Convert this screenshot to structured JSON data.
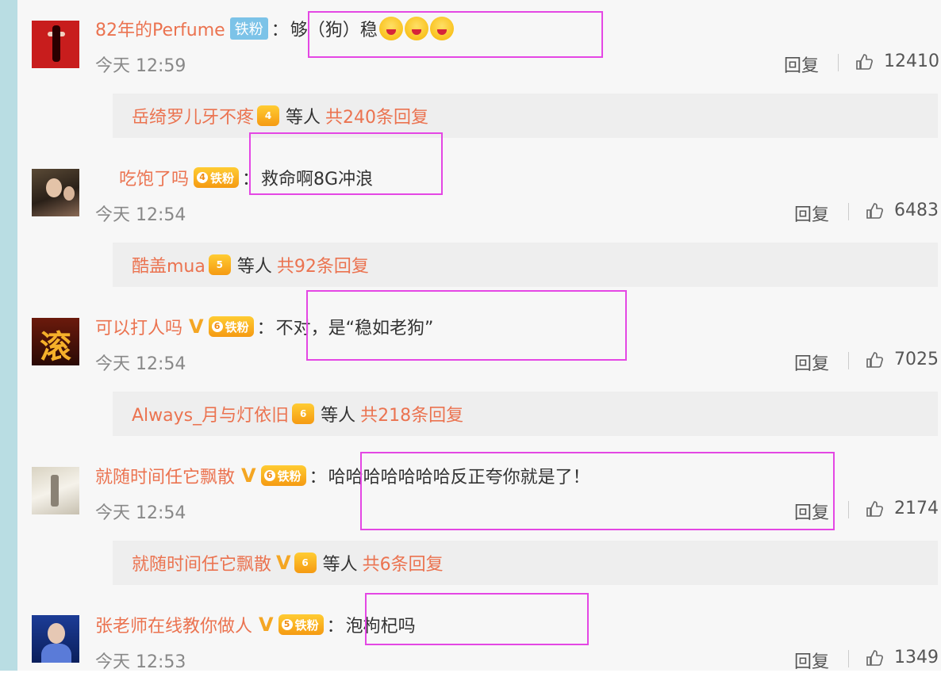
{
  "comments": [
    {
      "username": "82年的Perfume",
      "badge": "铁粉",
      "text": "够（狗）稳",
      "time": "今天 12:59",
      "reply": "回复",
      "likes": "12410",
      "has_v": false,
      "level": ""
    },
    {
      "username": "吃饱了吗",
      "badge": "铁粉",
      "text": "救命啊8G冲浪",
      "time": "今天 12:54",
      "reply": "回复",
      "likes": "6483",
      "has_v": false,
      "level": "4"
    },
    {
      "username": "可以打人吗",
      "badge": "铁粉",
      "text": "不对，是“稳如老狗”",
      "time": "今天 12:54",
      "reply": "回复",
      "likes": "7025",
      "has_v": true,
      "level": "6"
    },
    {
      "username": "就随时间任它飘散",
      "badge": "铁粉",
      "text": "哈哈哈哈哈哈哈反正夸你就是了！",
      "time": "今天 12:54",
      "reply": "回复",
      "likes": "2174",
      "has_v": true,
      "level": "6"
    },
    {
      "username": "张老师在线教你做人",
      "badge": "铁粉",
      "text": "泡枸杞吗",
      "time": "今天 12:53",
      "reply": "回复",
      "likes": "1349",
      "has_v": true,
      "level": "5"
    }
  ],
  "reply_bars": [
    {
      "user": "岳绮罗儿牙不疼",
      "level": "4",
      "has_v": false,
      "deng": "等人",
      "count": "共240条回复"
    },
    {
      "user": "酷盖mua",
      "level": "5",
      "has_v": false,
      "deng": "等人",
      "count": "共92条回复"
    },
    {
      "user": "Always_月与灯依旧",
      "level": "6",
      "has_v": false,
      "deng": "等人",
      "count": "共218条回复"
    },
    {
      "user": "就随时间任它飘散",
      "level": "6",
      "has_v": true,
      "deng": "等人",
      "count": "共6条回复"
    }
  ],
  "colon": "：",
  "v_mark": "V",
  "avatar_glyphs": {
    "c3": "滚"
  },
  "colors": {
    "username": "#eb7350",
    "highlight": "#e447e4",
    "badge_blue": "#7cc3e8",
    "crown": "#f59a12"
  },
  "icons": [
    "thumb-up-icon",
    "crown-icon",
    "v-verified-icon",
    "emoji-icon"
  ]
}
